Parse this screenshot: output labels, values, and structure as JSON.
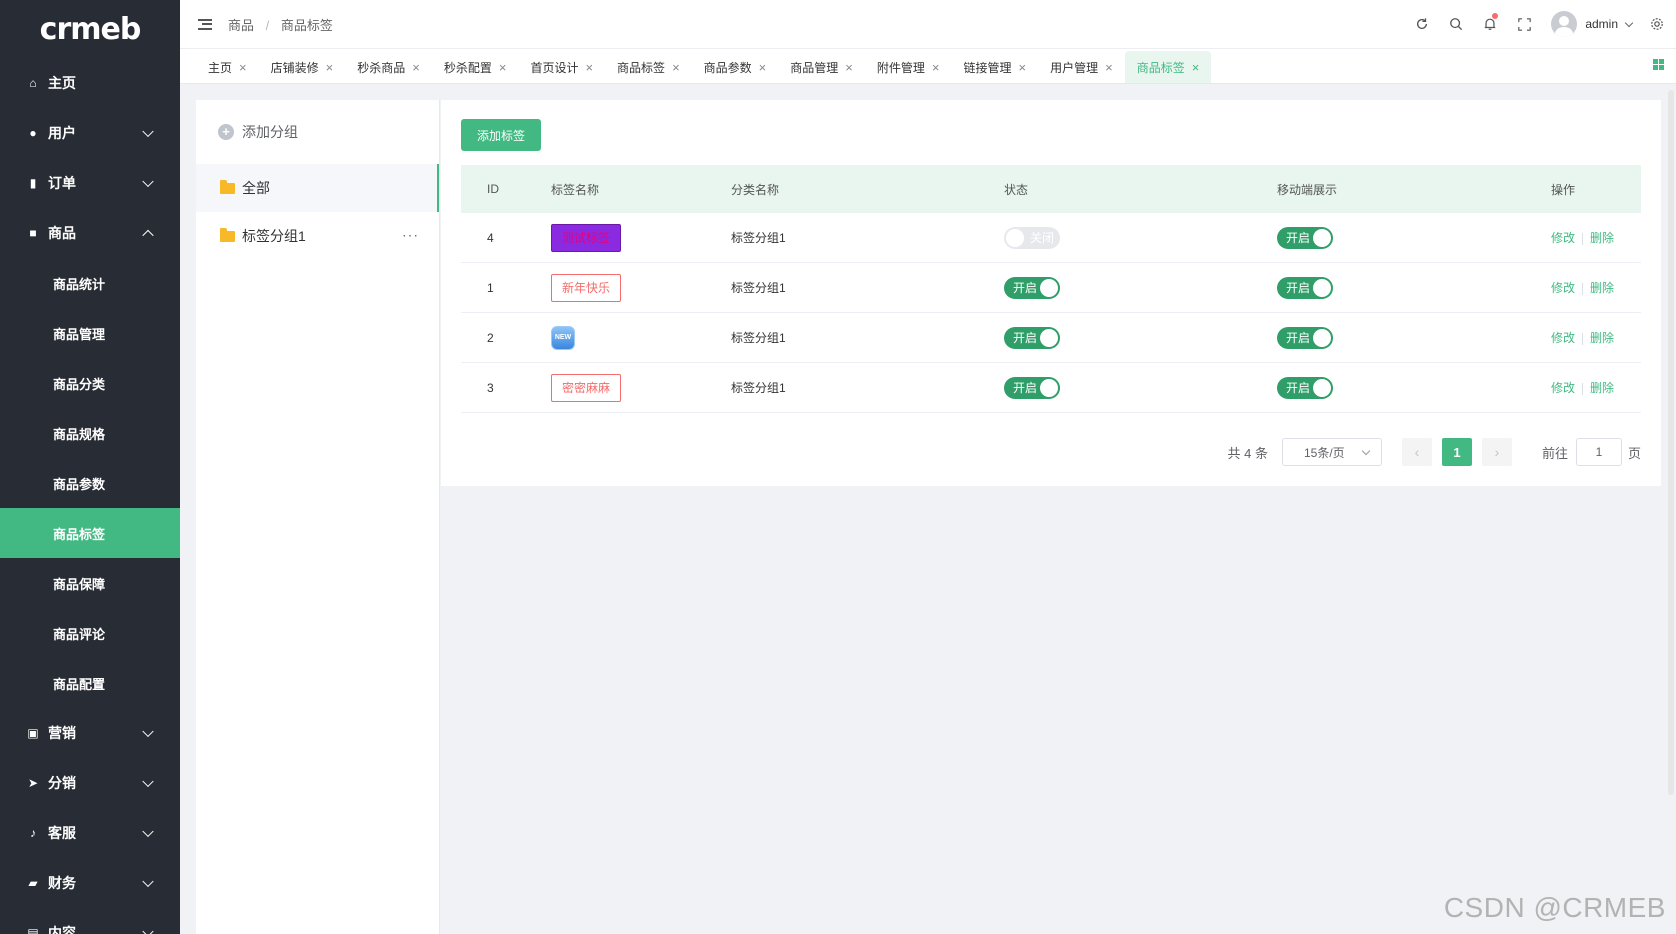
{
  "brand": {
    "logo": "crmeb"
  },
  "sidebar": {
    "items": [
      {
        "label": "主页",
        "icon": "home-icon",
        "expandable": false
      },
      {
        "label": "用户",
        "icon": "user-icon",
        "expandable": true
      },
      {
        "label": "订单",
        "icon": "order-icon",
        "expandable": true
      },
      {
        "label": "商品",
        "icon": "product-icon",
        "expandable": true,
        "expanded": true,
        "children": [
          "商品统计",
          "商品管理",
          "商品分类",
          "商品规格",
          "商品参数",
          "商品标签",
          "商品保障",
          "商品评论",
          "商品配置"
        ],
        "active_child": "商品标签"
      },
      {
        "label": "营销",
        "icon": "marketing-icon",
        "expandable": true
      },
      {
        "label": "分销",
        "icon": "distribution-icon",
        "expandable": true
      },
      {
        "label": "客服",
        "icon": "service-icon",
        "expandable": true
      },
      {
        "label": "财务",
        "icon": "finance-icon",
        "expandable": true
      },
      {
        "label": "内容",
        "icon": "content-icon",
        "expandable": true
      }
    ]
  },
  "header": {
    "breadcrumb": [
      "商品",
      "商品标签"
    ],
    "user_name": "admin",
    "icons": [
      "refresh-icon",
      "search-icon",
      "bell-icon",
      "fullscreen-icon",
      "settings-icon"
    ]
  },
  "tabs": [
    {
      "label": "主页"
    },
    {
      "label": "店铺装修"
    },
    {
      "label": "秒杀商品"
    },
    {
      "label": "秒杀配置"
    },
    {
      "label": "首页设计"
    },
    {
      "label": "商品标签"
    },
    {
      "label": "商品参数"
    },
    {
      "label": "商品管理"
    },
    {
      "label": "附件管理"
    },
    {
      "label": "链接管理"
    },
    {
      "label": "用户管理"
    },
    {
      "label": "商品标签",
      "active": true
    }
  ],
  "groups": {
    "add_label": "添加分组",
    "items": [
      {
        "label": "全部",
        "active": true
      },
      {
        "label": "标签分组1",
        "more": "···"
      }
    ]
  },
  "main": {
    "add_button": "添加标签",
    "columns": [
      "ID",
      "标签名称",
      "分类名称",
      "状态",
      "移动端展示",
      "操作"
    ],
    "rows": [
      {
        "id": "4",
        "tag": "测试标签",
        "tag_style": "purple",
        "category": "标签分组1",
        "status": "关闭",
        "status_on": false,
        "mobile": "开启",
        "mobile_on": true
      },
      {
        "id": "1",
        "tag": "新年快乐",
        "tag_style": "red-outline",
        "category": "标签分组1",
        "status": "开启",
        "status_on": true,
        "mobile": "开启",
        "mobile_on": true
      },
      {
        "id": "2",
        "tag": "NEW",
        "tag_style": "new-icon",
        "category": "标签分组1",
        "status": "开启",
        "status_on": true,
        "mobile": "开启",
        "mobile_on": true
      },
      {
        "id": "3",
        "tag": "密密麻麻",
        "tag_style": "red-outline",
        "category": "标签分组1",
        "status": "开启",
        "status_on": true,
        "mobile": "开启",
        "mobile_on": true
      }
    ],
    "actions": {
      "edit": "修改",
      "delete": "删除"
    }
  },
  "pagination": {
    "total_text": "共 4 条",
    "page_size": "15条/页",
    "current_page": "1",
    "goto_label": "前往",
    "goto_value": "1",
    "page_suffix": "页"
  },
  "watermark": "CSDN @CRMEB",
  "colors": {
    "accent": "#42b983",
    "sidebar_bg": "#282c34",
    "danger": "#f56c6c",
    "tag_purple": "#8a2be2"
  }
}
